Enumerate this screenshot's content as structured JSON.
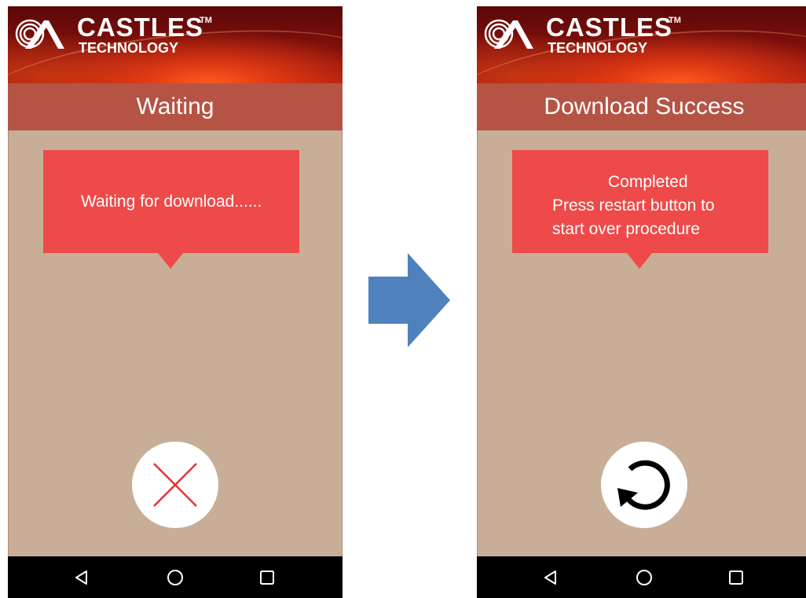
{
  "brand": {
    "name": "CASTLES",
    "tm": "TM",
    "subtitle": "TECHNOLOGY"
  },
  "screens": [
    {
      "title": "Waiting",
      "message": "Waiting for download......",
      "action_icon": "close-icon",
      "action_icon_color": "#e8302c"
    },
    {
      "title": "Download Success",
      "message_lines": [
        "Completed",
        "Press restart button to",
        "start over procedure"
      ],
      "action_icon": "restart-icon"
    }
  ],
  "nav_icons": [
    "back-icon",
    "home-icon",
    "recent-apps-icon"
  ],
  "colors": {
    "title_bar": "#b55445",
    "body": "#c8ae97",
    "bubble": "#ee4a49",
    "arrow": "#4f81bd",
    "nav_bar": "#000000"
  }
}
